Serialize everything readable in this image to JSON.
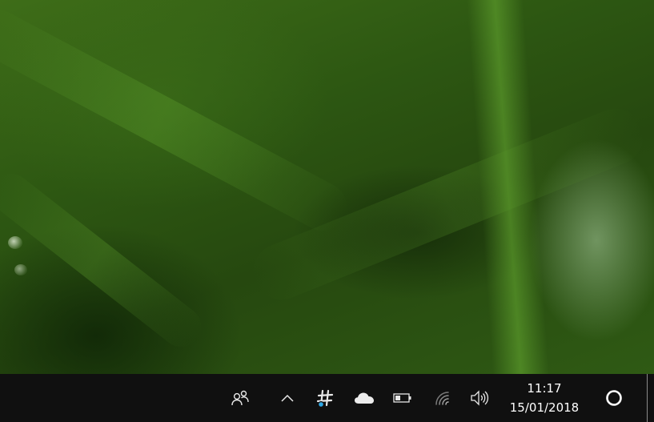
{
  "taskbar": {
    "clock": {
      "time": "11:17",
      "date": "15/01/2018"
    },
    "tray_icons": [
      "people-icon",
      "chevron-up-icon",
      "slack-icon",
      "onedrive-cloud-icon",
      "battery-icon",
      "wifi-icon",
      "volume-icon"
    ],
    "cortana": "cortana-circle-icon",
    "colors": {
      "taskbar_bg": "#101010",
      "slack_dot": "#2fa8e6",
      "text": "#ffffff"
    }
  }
}
